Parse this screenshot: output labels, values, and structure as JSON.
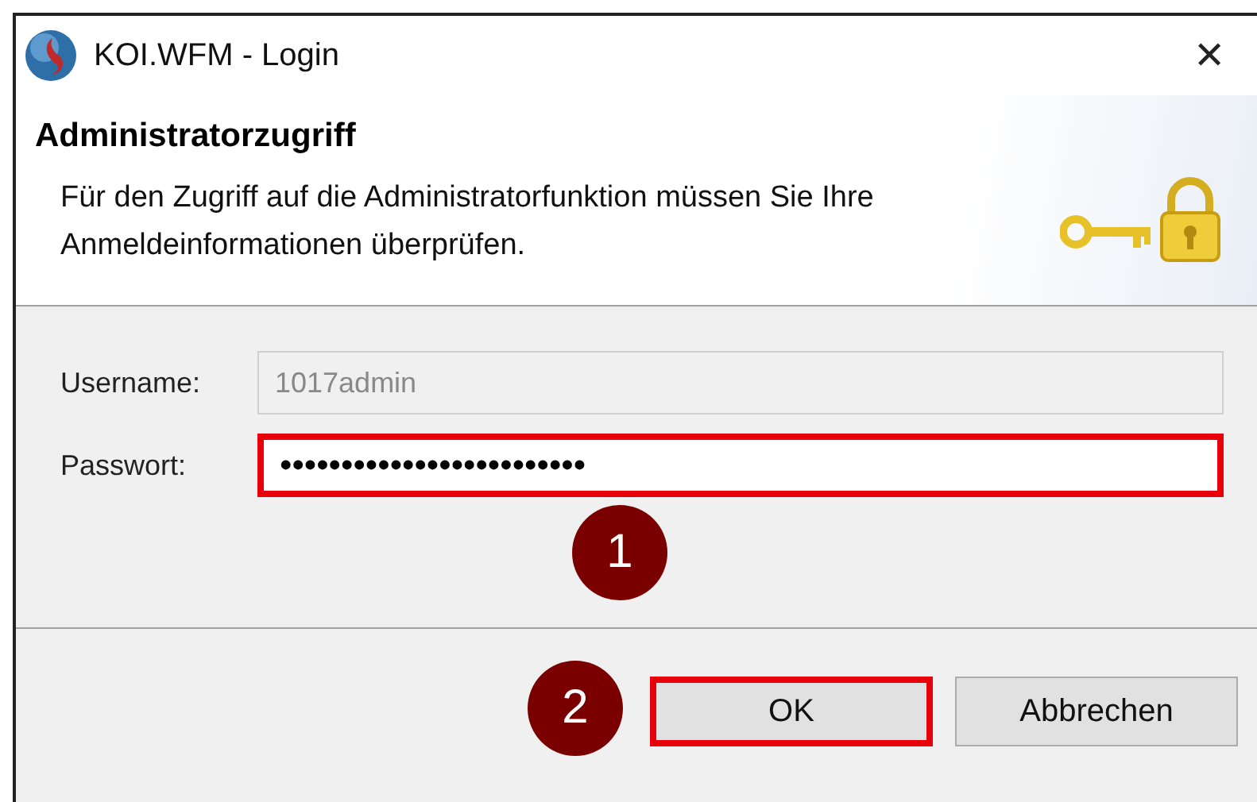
{
  "window": {
    "title": "KOI.WFM - Login",
    "close": "✕"
  },
  "header": {
    "title": "Administratorzugriff",
    "description": "Für den Zugriff auf die Administratorfunktion müssen Sie Ihre Anmeldeinformationen überprüfen."
  },
  "fields": [
    {
      "label": "Username:",
      "value": "1017admin",
      "disabled": true,
      "highlighted": false
    },
    {
      "label": "Passwort:",
      "value": "•••••••••••••••••••••••••",
      "disabled": false,
      "highlighted": true,
      "step": "1"
    }
  ],
  "buttons": [
    {
      "label": "OK",
      "highlighted": true,
      "step": "2"
    },
    {
      "label": "Abbrechen",
      "highlighted": false
    }
  ]
}
